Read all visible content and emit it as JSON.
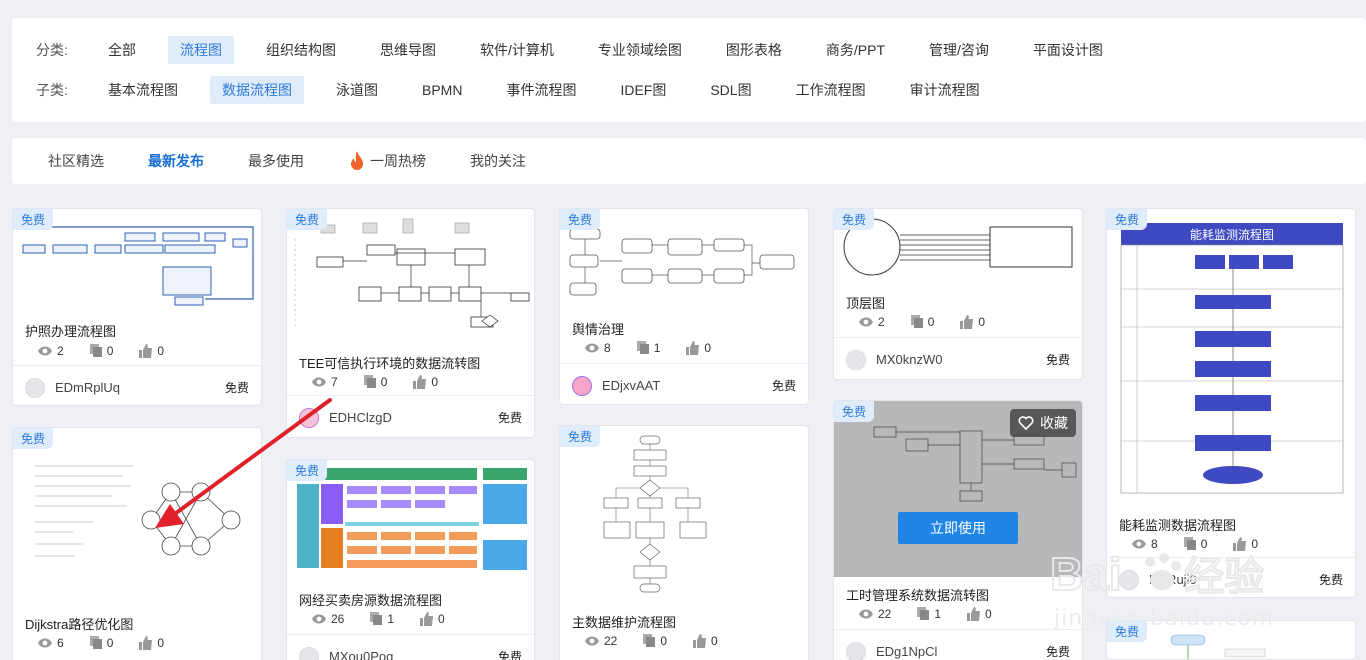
{
  "filter": {
    "category_label": "分类:",
    "categories": [
      "全部",
      "流程图",
      "组织结构图",
      "思维导图",
      "软件/计算机",
      "专业领域绘图",
      "图形表格",
      "商务/PPT",
      "管理/咨询",
      "平面设计图"
    ],
    "subcategory_label": "子类:",
    "subcategories": [
      "基本流程图",
      "数据流程图",
      "泳道图",
      "BPMN",
      "事件流程图",
      "IDEF图",
      "SDL图",
      "工作流程图",
      "审计流程图"
    ]
  },
  "tabs": [
    "社区精选",
    "最新发布",
    "最多使用",
    "一周热榜",
    "我的关注"
  ],
  "badge": "免费",
  "overlay": {
    "use_button": "立即使用",
    "fav_label": "收藏"
  },
  "cards": [
    {
      "title": "护照办理流程图",
      "views": "2",
      "copies": "0",
      "likes": "0",
      "user": "EDmRplUq",
      "price": "免费"
    },
    {
      "title": "Dijkstra路径优化图",
      "views": "6",
      "copies": "0",
      "likes": "0",
      "user": "",
      "price": ""
    },
    {
      "title": "TEE可信执行环境的数据流转图",
      "views": "7",
      "copies": "0",
      "likes": "0",
      "user": "EDHClzgD",
      "price": "免费"
    },
    {
      "title": "网经买卖房源数据流程图",
      "views": "26",
      "copies": "1",
      "likes": "0",
      "user": "MXou0Pog",
      "price": "免费"
    },
    {
      "title": "舆情治理",
      "views": "8",
      "copies": "1",
      "likes": "0",
      "user": "EDjxvAAT",
      "price": "免费"
    },
    {
      "title": "主数据维护流程图",
      "views": "22",
      "copies": "0",
      "likes": "0",
      "user": "",
      "price": ""
    },
    {
      "title": "顶层图",
      "views": "2",
      "copies": "0",
      "likes": "0",
      "user": "MX0knzW0",
      "price": "免费"
    },
    {
      "title": "工时管理系统数据流转图",
      "views": "22",
      "copies": "1",
      "likes": "0",
      "user": "EDg1NpCl",
      "price": "免费"
    },
    {
      "title": "能耗监测数据流程图",
      "views": "8",
      "copies": "0",
      "likes": "0",
      "user": "EDRuji0",
      "price": "免费"
    }
  ],
  "thumb_texts": {
    "energy_title": "能耗监测流程图"
  },
  "watermark": {
    "site": "jingyan.baidu.com",
    "brand": "Bai",
    "brand2": "经验"
  }
}
